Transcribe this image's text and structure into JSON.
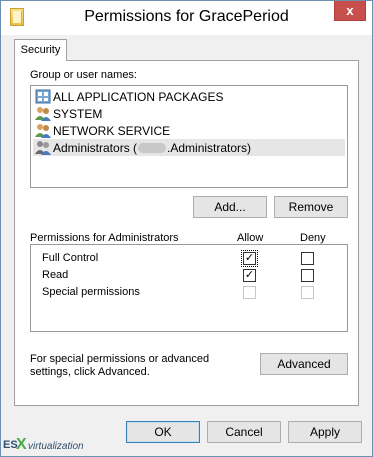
{
  "window": {
    "title": "Permissions for GracePeriod",
    "close_glyph": "x"
  },
  "tab": {
    "label": "Security"
  },
  "users": {
    "label": "Group or user names:",
    "items": [
      {
        "name": "ALL APPLICATION PACKAGES",
        "icon": "app-packages-icon"
      },
      {
        "name": "SYSTEM",
        "icon": "users-group-icon"
      },
      {
        "name": "NETWORK SERVICE",
        "icon": "users-group-icon"
      },
      {
        "name_prefix": "Administrators (",
        "name_suffix": ".Administrators)",
        "icon": "users-group-icon",
        "selected": true
      }
    ]
  },
  "buttons": {
    "add": "Add...",
    "remove": "Remove",
    "advanced": "Advanced",
    "ok": "OK",
    "cancel": "Cancel",
    "apply": "Apply"
  },
  "permissions": {
    "label": "Permissions for Administrators",
    "allow_header": "Allow",
    "deny_header": "Deny",
    "rows": [
      {
        "name": "Full Control",
        "allow": true,
        "deny": false
      },
      {
        "name": "Read",
        "allow": true,
        "deny": false
      },
      {
        "name": "Special permissions",
        "allow": false,
        "deny": false,
        "disabled": true
      }
    ]
  },
  "advanced_note": "For special permissions or advanced settings, click Advanced.",
  "watermark": {
    "es": "ES",
    "x": "X",
    "v": "virtualization"
  },
  "colors": {
    "close": "#c7504c",
    "default_border": "#3c7fb1",
    "selection": "#e6e6e6"
  }
}
